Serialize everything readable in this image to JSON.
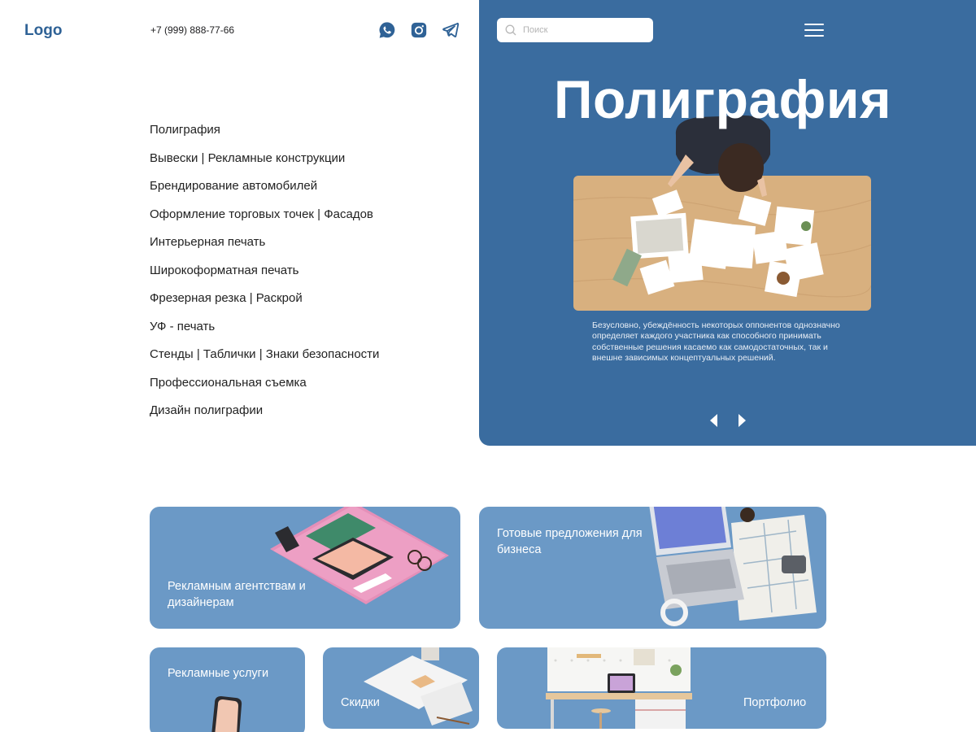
{
  "header": {
    "logo": "Logo",
    "phone": "+7 (999) 888-77-66",
    "socials": [
      "whatsapp-icon",
      "instagram-icon",
      "telegram-icon"
    ]
  },
  "menu": {
    "items": [
      "Полиграфия",
      "Вывески | Рекламные конструкции",
      "Брендирование автомобилей",
      "Оформление торговых точек | Фасадов",
      "Интерьерная печать",
      "Широкоформатная печать",
      "Фрезерная резка | Раскрой",
      "УФ - печать",
      "Стенды | Таблички | Знаки безопасности",
      "Профессиональная съемка",
      "Дизайн полиграфии"
    ]
  },
  "hero": {
    "search_placeholder": "Поиск",
    "title": "Полиграфия",
    "description": "Безусловно, убеждённость некоторых оппонентов однозначно определяет каждого участника как способного принимать собственные решения касаемо как самодостаточных, так и внешне зависимых концептуальных решений."
  },
  "cards": {
    "agencies": "Рекламным агентствам и дизайнерам",
    "business": "Готовые предложения для бизнеса",
    "services": "Рекламные услуги",
    "discounts": "Скидки",
    "portfolio": "Портфолио"
  },
  "colors": {
    "brand": "#3a6c9f",
    "card": "#6b99c6",
    "logo": "#2f6296"
  }
}
